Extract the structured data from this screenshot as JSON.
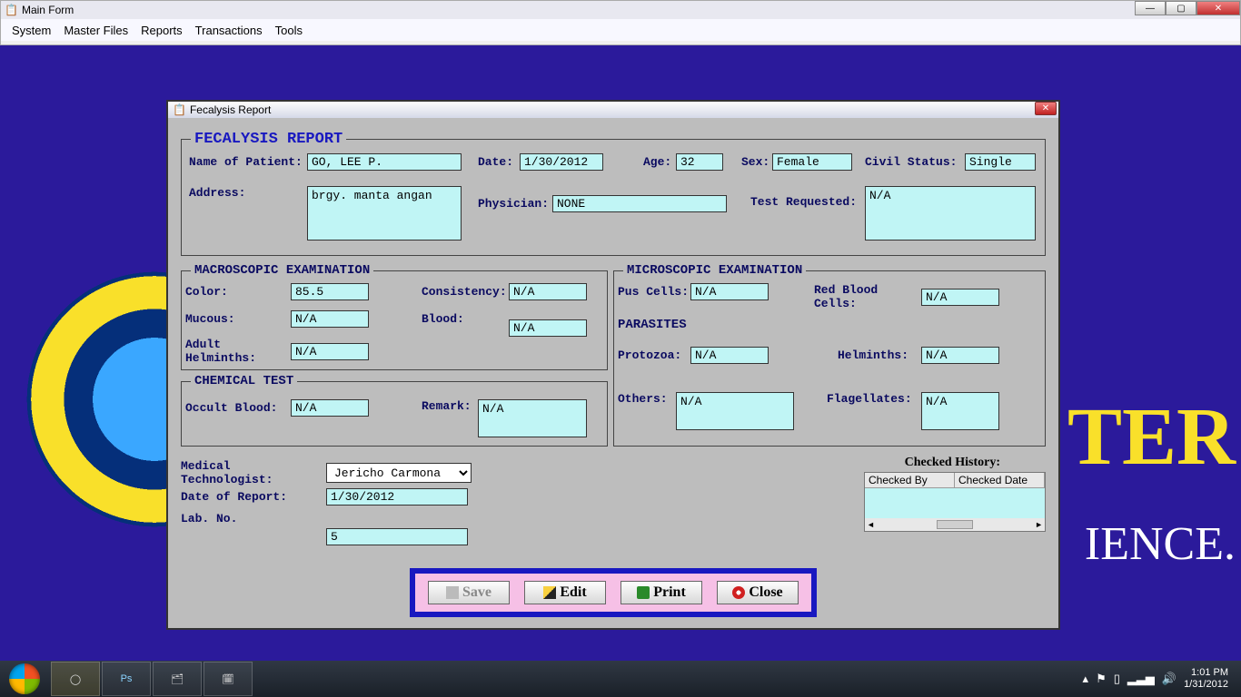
{
  "mainWindow": {
    "title": "Main Form"
  },
  "menubar": [
    "System",
    "Master Files",
    "Reports",
    "Transactions",
    "Tools"
  ],
  "background": {
    "fragment1": "TER",
    "fragment2": "IENCE."
  },
  "dialog": {
    "title": "Fecalysis Report",
    "heading": "FECALYSIS REPORT",
    "patient": {
      "nameLabel": "Name of Patient:",
      "name": "GO, LEE P.",
      "dateLabel": "Date:",
      "date": "1/30/2012",
      "ageLabel": "Age:",
      "age": "32",
      "sexLabel": "Sex:",
      "sex": "Female",
      "civilLabel": "Civil Status:",
      "civil": "Single",
      "addressLabel": "Address:",
      "address": "brgy. manta angan",
      "physicianLabel": "Physician:",
      "physician": "NONE",
      "testReqLabel": "Test Requested:",
      "testReq": "N/A"
    },
    "macro": {
      "legend": "MACROSCOPIC EXAMINATION",
      "colorLabel": "Color:",
      "color": "85.5",
      "consistencyLabel": "Consistency:",
      "consistency": "N/A",
      "mucousLabel": "Mucous:",
      "mucous": "N/A",
      "bloodLabel": "Blood:",
      "blood": "N/A",
      "adultHelmLabel": "Adult Helminths:",
      "adultHelm": "N/A"
    },
    "chem": {
      "legend": "CHEMICAL TEST",
      "occultLabel": "Occult Blood:",
      "occult": "N/A",
      "remarkLabel": "Remark:",
      "remark": "N/A"
    },
    "micro": {
      "legend": "MICROSCOPIC EXAMINATION",
      "pusLabel": "Pus Cells:",
      "pus": "N/A",
      "rbcLabel": "Red Blood Cells:",
      "rbc": "N/A",
      "parasitesLabel": "PARASITES",
      "protozoaLabel": "Protozoa:",
      "protozoa": "N/A",
      "helmLabel": "Helminths:",
      "helm": "N/A",
      "othersLabel": "Others:",
      "others": "N/A",
      "flagLabel": "Flagellates:",
      "flag": "N/A"
    },
    "footer": {
      "medTechLabel": "Medical Technologist:",
      "medTech": "Jericho Carmona",
      "dorLabel": "Date of Report:",
      "dor": "1/30/2012",
      "labLabel": "Lab. No.",
      "lab": "5",
      "historyLabel": "Checked History:",
      "historyCols": [
        "Checked By",
        "Checked Date"
      ]
    },
    "buttons": {
      "save": "Save",
      "edit": "Edit",
      "print": "Print",
      "close": "Close"
    }
  },
  "taskbar": {
    "tasks": [
      "",
      "",
      "Ps",
      "",
      ""
    ],
    "time": "1:01 PM",
    "date": "1/31/2012"
  }
}
